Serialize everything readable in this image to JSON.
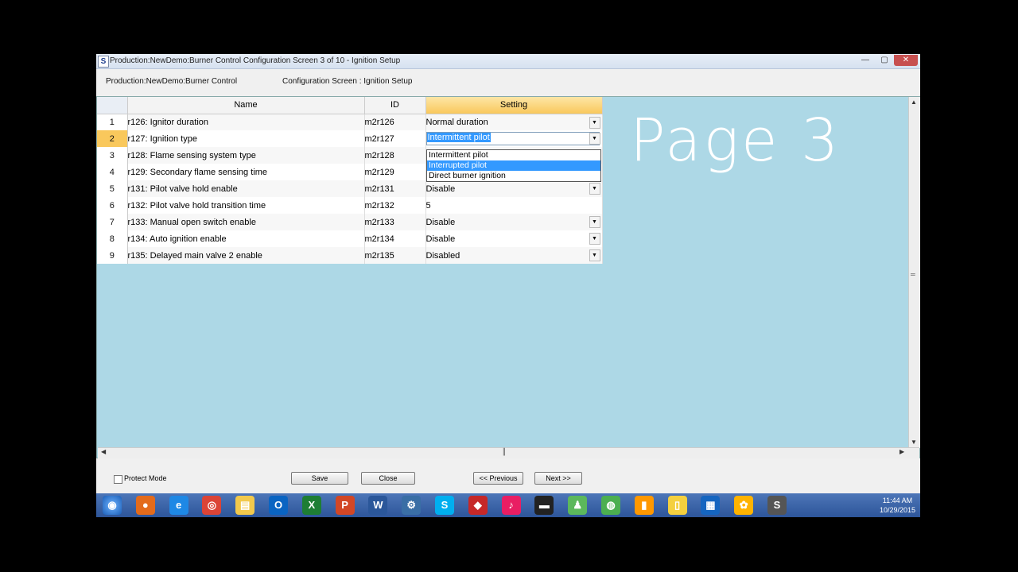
{
  "window": {
    "title": "Production:NewDemo:Burner Control Configuration Screen 3 of 10 - Ignition Setup",
    "app_icon_letter": "S",
    "minimize": "—",
    "maximize": "▢",
    "close": "✕"
  },
  "info": {
    "left": "Production:NewDemo:Burner Control",
    "right": "Configuration Screen : Ignition Setup"
  },
  "grid": {
    "headers": {
      "name": "Name",
      "id": "ID",
      "setting": "Setting"
    },
    "rows": [
      {
        "num": "1",
        "name": "r126: Ignitor duration",
        "id": "m2r126",
        "setting": "Normal duration",
        "dropdown": true
      },
      {
        "num": "2",
        "name": "r127: Ignition type",
        "id": "m2r127",
        "setting": "Intermittent pilot",
        "dropdown": true,
        "active": true
      },
      {
        "num": "3",
        "name": "r128: Flame sensing system type",
        "id": "m2r128",
        "setting": "",
        "dropdown": false
      },
      {
        "num": "4",
        "name": "r129: Secondary flame sensing time",
        "id": "m2r129",
        "setting": "",
        "dropdown": false
      },
      {
        "num": "5",
        "name": "r131: Pilot valve hold enable",
        "id": "m2r131",
        "setting": "Disable",
        "dropdown": true
      },
      {
        "num": "6",
        "name": "r132: Pilot valve hold transition time",
        "id": "m2r132",
        "setting": "5",
        "dropdown": false
      },
      {
        "num": "7",
        "name": "r133: Manual open switch enable",
        "id": "m2r133",
        "setting": "Disable",
        "dropdown": true
      },
      {
        "num": "8",
        "name": "r134: Auto ignition enable",
        "id": "m2r134",
        "setting": "Disable",
        "dropdown": true
      },
      {
        "num": "9",
        "name": "r135: Delayed main valve 2 enable",
        "id": "m2r135",
        "setting": "Disabled",
        "dropdown": true
      }
    ]
  },
  "dropdown_options": [
    "Intermittent pilot",
    "Interrupted pilot",
    "Direct burner ignition"
  ],
  "dropdown_hover_index": 1,
  "overlay_text": "Page 3",
  "bottom": {
    "protect_mode": "Protect Mode",
    "save": "Save",
    "close": "Close",
    "previous": "<< Previous",
    "next": "Next >>"
  },
  "taskbar": {
    "icons": [
      "start-orb",
      "firefox",
      "internet-explorer",
      "chrome",
      "file-explorer",
      "outlook",
      "excel",
      "powerpoint",
      "word",
      "settings-app",
      "skype",
      "red-app",
      "itunes",
      "car-app",
      "green-app",
      "globe-app",
      "orange-app",
      "notes-app",
      "grid-app",
      "flower-app",
      "s-app"
    ],
    "time": "11:44 AM",
    "date": "10/29/2015"
  }
}
